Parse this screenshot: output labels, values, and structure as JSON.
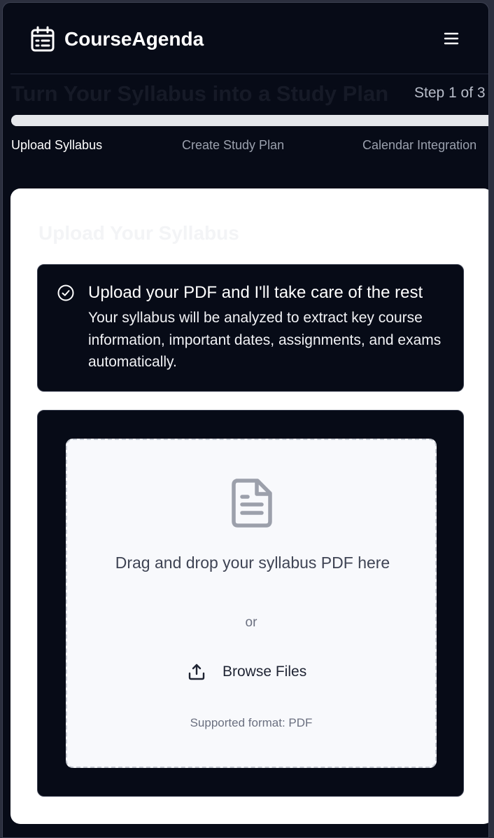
{
  "header": {
    "app_title": "CourseAgenda",
    "logo_icon": "calendar-icon",
    "menu_icon": "hamburger-menu-icon"
  },
  "progress": {
    "page_title": "Turn Your Syllabus into a Study Plan",
    "step_label": "Step 1 of 3",
    "current_step": 1,
    "total_steps": 3,
    "steps": [
      {
        "label": "Upload Syllabus",
        "active": true
      },
      {
        "label": "Create Study Plan",
        "active": false
      },
      {
        "label": "Calendar Integration",
        "active": false
      }
    ]
  },
  "card": {
    "title": "Upload Your Syllabus",
    "info": {
      "icon": "check-circle-icon",
      "title": "Upload your PDF and I'll take care of the rest",
      "text": "Your syllabus will be analyzed to extract key course information, important dates, assignments, and exams automatically."
    },
    "upload": {
      "icon": "document-icon",
      "drop_text": "Drag and drop your syllabus PDF here",
      "or_text": "or",
      "browse_icon": "upload-icon",
      "browse_label": "Browse Files",
      "format_text": "Supported format: PDF"
    }
  },
  "colors": {
    "background": "#070b17",
    "card": "#ffffff",
    "dropzone": "#f8f9fc",
    "track": "#e5e7eb"
  }
}
